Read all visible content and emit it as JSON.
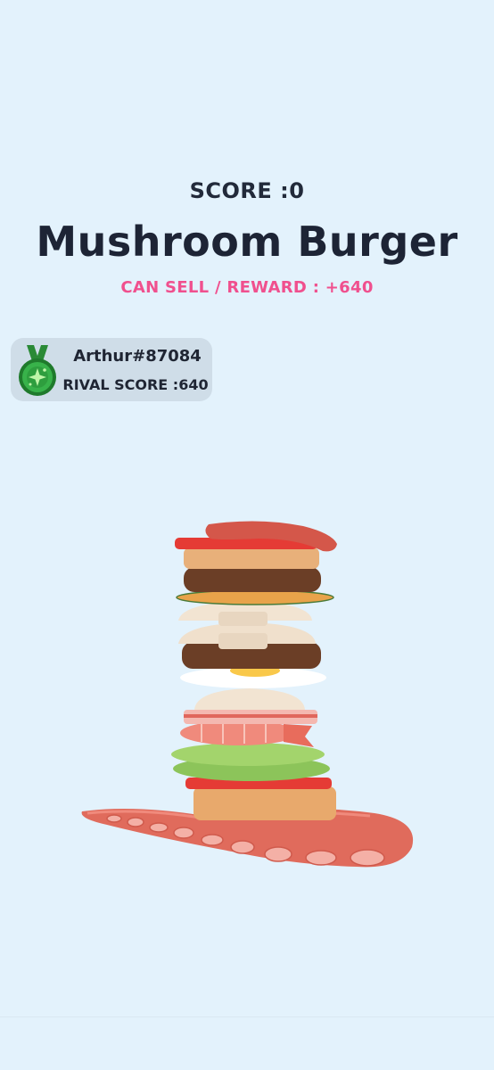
{
  "hud": {
    "score_text": "SCORE :0",
    "burger_name": "Mushroom Burger",
    "reward_text": "CAN SELL / REWARD : +640"
  },
  "rival": {
    "name": "Arthur#87084",
    "score_text": "RIVAL SCORE :640",
    "medal_icon": "green-medal-icon"
  },
  "colors": {
    "background": "#e3f2fc",
    "reward_pink": "#f0508e",
    "text_dark": "#1d2435",
    "medal_green": "#2e9e3e"
  },
  "burger_layers": [
    "sausage",
    "tomato",
    "top-bun",
    "patty",
    "cucumber",
    "mushroom",
    "mushroom",
    "patty",
    "fried-egg",
    "mushroom",
    "bacon",
    "shrimp",
    "lettuce",
    "tomato",
    "bottom-bun",
    "octopus-tentacle"
  ]
}
